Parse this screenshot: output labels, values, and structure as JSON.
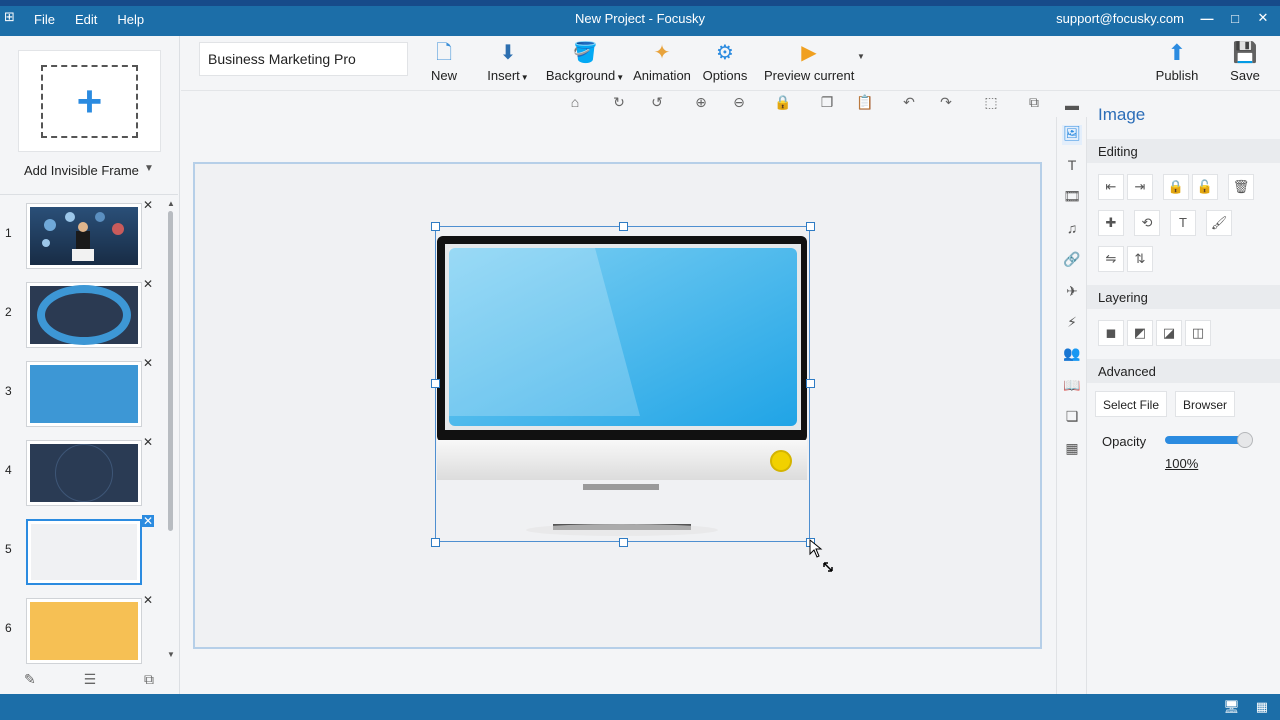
{
  "window": {
    "title": "New Project - Focusky",
    "support_email": "support@focusky.com",
    "menu": [
      "File",
      "Edit",
      "Help"
    ],
    "controls": [
      "—",
      "□",
      "✕"
    ]
  },
  "left_panel": {
    "add_frame_label": "Add Invisible Frame",
    "slides": [
      {
        "number": "1",
        "color": "#1f3a5c",
        "active": false
      },
      {
        "number": "2",
        "color": "#2b3a52",
        "active": false
      },
      {
        "number": "3",
        "color": "#3d97d5",
        "active": false
      },
      {
        "number": "4",
        "color": "#2a3b54",
        "active": false
      },
      {
        "number": "5",
        "color": "#f0f1f3",
        "active": true
      },
      {
        "number": "6",
        "color": "#f6c054",
        "active": false
      }
    ]
  },
  "toolbar": {
    "project_name": "Business Marketing Pro",
    "new_label": "New",
    "insert_label": "Insert",
    "background_label": "Background",
    "animation_label": "Animation",
    "options_label": "Options",
    "preview_label": "Preview current",
    "publish_label": "Publish",
    "save_label": "Save"
  },
  "right_panel": {
    "title": "Image",
    "editing_label": "Editing",
    "layering_label": "Layering",
    "advanced_label": "Advanced",
    "select_file_label": "Select File",
    "browser_label": "Browser",
    "opacity_label": "Opacity",
    "opacity_value": "100%",
    "opacity_level": 1.0
  },
  "colors": {
    "accent": "#2b8be0",
    "titlebar": "#1c6ea8",
    "selection": "#2f7cc4"
  }
}
